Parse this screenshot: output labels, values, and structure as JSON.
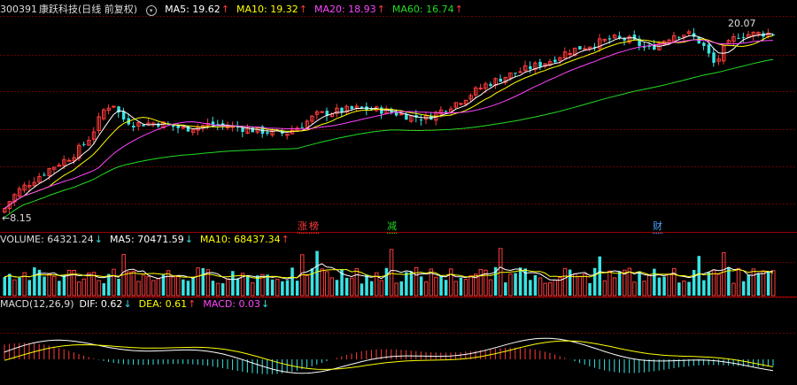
{
  "price_panel": {
    "code": "300391",
    "name": "康跃科技",
    "period": "(日线 前复权)",
    "ma5_label": "MA5: 19.62",
    "ma10_label": "MA10: 19.32",
    "ma20_label": "MA20: 18.93",
    "ma60_label": "MA60: 16.74",
    "up_arrow": "↑",
    "high_label": "20.07",
    "low_label": "8.15",
    "low_arrow": "←",
    "markers": [
      {
        "text": "涨",
        "color": "#ff3b3b"
      },
      {
        "text": "榜",
        "color": "#ff3b3b"
      },
      {
        "text": "减",
        "color": "#25d425"
      },
      {
        "text": "财",
        "color": "#4da3ff"
      }
    ]
  },
  "volume_panel": {
    "volume_label": "VOLUME: 64321.24",
    "volume_arrow": "↓",
    "ma5_label": "MA5: 70471.59",
    "ma5_arrow": "↓",
    "ma10_label": "MA10: 68437.34",
    "ma10_arrow": "↑"
  },
  "macd_panel": {
    "macd_label": "MACD(12,26,9)",
    "dif_label": "DIF: 0.62",
    "dif_arrow": "↓",
    "dea_label": "DEA: 0.61",
    "dea_arrow": "↑",
    "macd_value_label": "MACD: 0.03",
    "macd_arrow": "↓"
  },
  "colors": {
    "up": "#ff3b3b",
    "down": "#39e3e3",
    "ma5": "#ffffff",
    "ma10": "#ffff00",
    "ma20": "#ff44ff",
    "ma60": "#22dd22",
    "grid": "#6b0000"
  },
  "chart_data": {
    "type": "candlestick",
    "ylim": [
      8.15,
      20.07
    ],
    "anchors": [
      [
        0,
        8.15
      ],
      [
        10,
        9.0
      ],
      [
        20,
        9.6
      ],
      [
        35,
        10.2
      ],
      [
        55,
        11.0
      ],
      [
        80,
        11.8
      ],
      [
        100,
        13.0
      ],
      [
        115,
        14.7
      ],
      [
        125,
        15.2
      ],
      [
        135,
        14.2
      ],
      [
        150,
        13.8
      ],
      [
        175,
        13.9
      ],
      [
        205,
        13.5
      ],
      [
        235,
        13.8
      ],
      [
        265,
        13.6
      ],
      [
        300,
        13.3
      ],
      [
        320,
        13.2
      ],
      [
        340,
        13.8
      ],
      [
        355,
        14.4
      ],
      [
        375,
        14.6
      ],
      [
        400,
        14.8
      ],
      [
        430,
        14.7
      ],
      [
        460,
        14.3
      ],
      [
        480,
        14.2
      ],
      [
        500,
        14.8
      ],
      [
        520,
        15.4
      ],
      [
        545,
        16.3
      ],
      [
        570,
        16.9
      ],
      [
        595,
        17.4
      ],
      [
        620,
        17.9
      ],
      [
        640,
        18.5
      ],
      [
        665,
        18.9
      ],
      [
        690,
        19.3
      ],
      [
        710,
        19.2
      ],
      [
        730,
        18.6
      ],
      [
        745,
        19.1
      ],
      [
        760,
        19.6
      ],
      [
        775,
        19.6
      ],
      [
        790,
        19.0
      ],
      [
        805,
        17.6
      ],
      [
        815,
        18.6
      ],
      [
        830,
        19.5
      ],
      [
        850,
        19.6
      ],
      [
        877,
        19.65
      ]
    ]
  }
}
